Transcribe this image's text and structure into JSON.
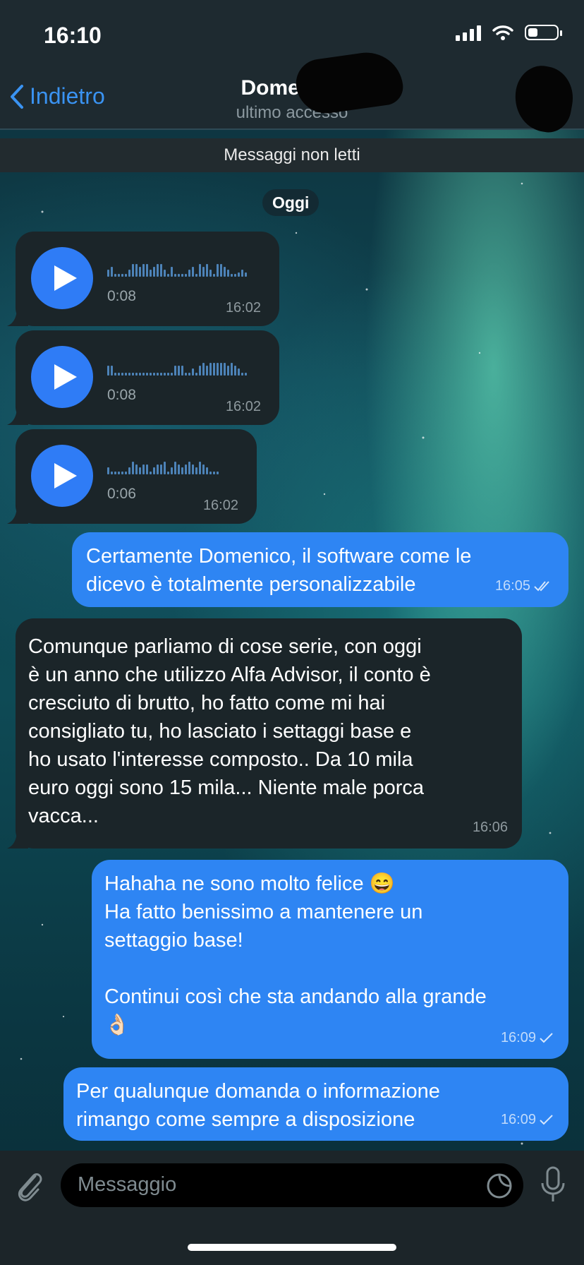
{
  "status_bar": {
    "time": "16:10",
    "battery_level": 0.35
  },
  "header": {
    "back_label": "Indietro",
    "contact_name": "Domenico",
    "last_seen": "ultimo accesso"
  },
  "unread_banner": "Messaggi non letti",
  "date_pill": "Oggi",
  "voice_messages": [
    {
      "duration": "0:08",
      "time": "16:02"
    },
    {
      "duration": "0:08",
      "time": "16:02"
    },
    {
      "duration": "0:06",
      "time": "16:02"
    }
  ],
  "messages": [
    {
      "direction": "outgoing",
      "lines": [
        "Certamente Domenico, il software come le",
        "dicevo è totalmente personalizzabile"
      ],
      "time": "16:05",
      "status": "read"
    },
    {
      "direction": "incoming",
      "lines": [
        "Comunque parliamo di cose serie, con oggi",
        "è un anno che utilizzo Alfa Advisor, il conto è",
        "cresciuto di brutto, ho fatto come mi hai",
        "consigliato tu, ho lasciato i settaggi base e",
        "ho usato l'interesse composto.. Da 10 mila",
        "euro oggi sono 15 mila... Niente male porca",
        "vacca..."
      ],
      "time": "16:06"
    },
    {
      "direction": "outgoing",
      "lines": [
        "Hahaha ne sono molto felice 😄",
        "Ha fatto benissimo a mantenere un",
        "settaggio base!",
        "",
        "Continui così che sta andando alla grande",
        "👌🏻"
      ],
      "time": "16:09",
      "status": "sent"
    },
    {
      "direction": "outgoing",
      "lines": [
        "Per qualunque domanda o informazione",
        "rimango come sempre a disposizione"
      ],
      "time": "16:09",
      "status": "sent"
    }
  ],
  "composer": {
    "placeholder": "Messaggio"
  },
  "icons": {
    "back": "chevron-left-icon",
    "attach": "paperclip-icon",
    "sticker": "sticker-icon",
    "mic": "microphone-icon",
    "play": "play-icon"
  },
  "colors": {
    "accent": "#2e85f3",
    "incoming_bubble": "#1b2529"
  }
}
